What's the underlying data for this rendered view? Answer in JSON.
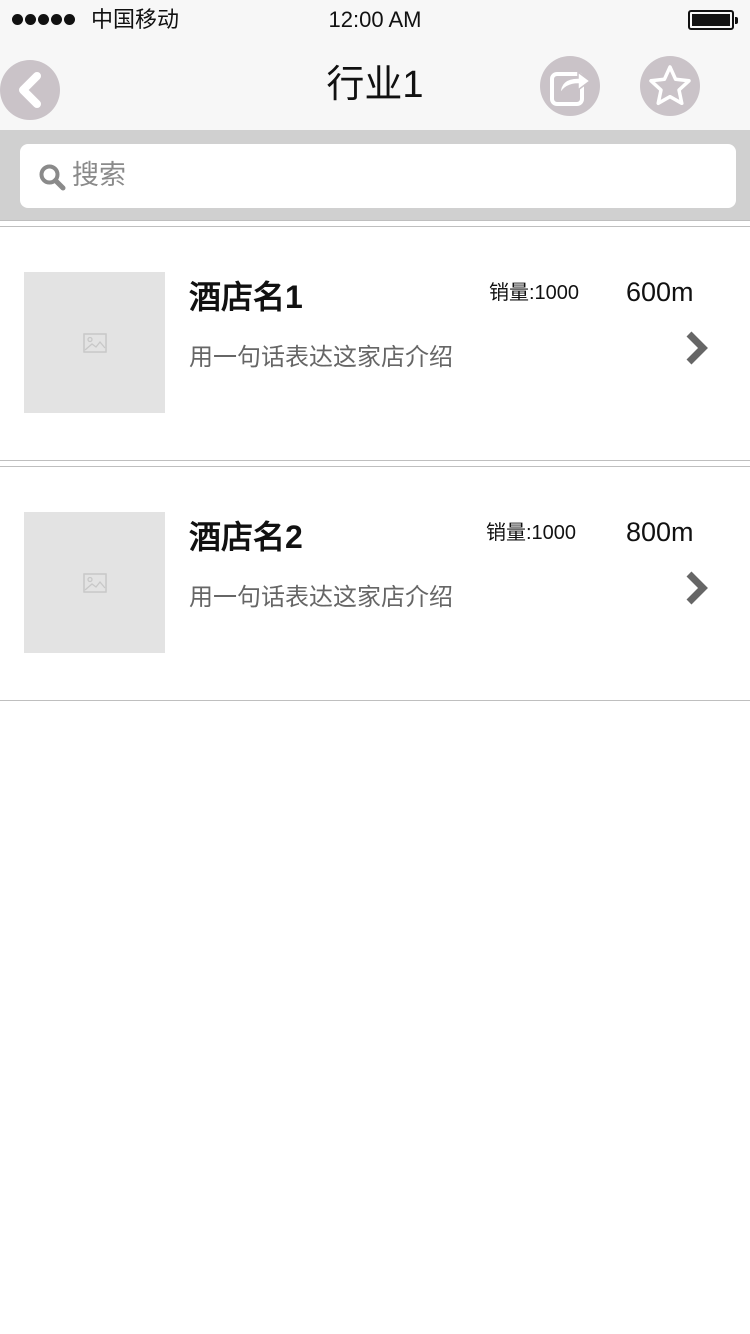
{
  "status_bar": {
    "carrier": "中国移动",
    "time": "12:00 AM",
    "signal_bars": 5,
    "battery_level": 1.0
  },
  "nav": {
    "title": "行业1",
    "back_icon": "chevron-left-icon",
    "share_icon": "share-icon",
    "favorite_icon": "star-icon"
  },
  "search": {
    "placeholder": "搜索",
    "icon": "search-icon"
  },
  "items": [
    {
      "name": "酒店名1",
      "description": "用一句话表达这家店介绍",
      "sales": "销量:1000",
      "distance": "600m"
    },
    {
      "name": "酒店名2",
      "description": "用一句话表达这家店介绍",
      "sales": "销量:1000",
      "distance": "800m"
    }
  ],
  "colors": {
    "nav_background": "#f7f7f7",
    "search_area_background": "#d0d0d0",
    "icon_circle": "#cac3c8",
    "thumbnail_placeholder": "#e3e3e3",
    "divider": "#bfbfbf"
  }
}
